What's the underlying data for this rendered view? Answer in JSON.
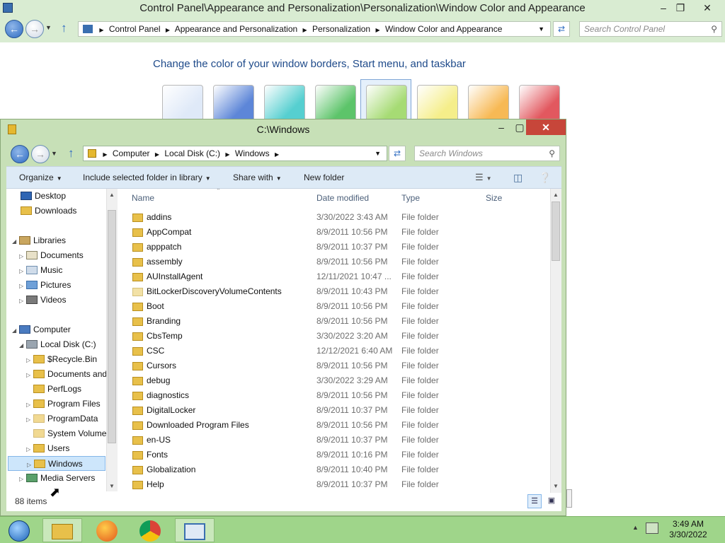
{
  "control_panel": {
    "title": "Control Panel\\Appearance and Personalization\\Personalization\\Window Color and Appearance",
    "breadcrumb": [
      "Control Panel",
      "Appearance and Personalization",
      "Personalization",
      "Window Color and Appearance"
    ],
    "search_placeholder": "Search Control Panel",
    "heading": "Change the color of your window borders, Start menu, and taskbar",
    "swatch_colors": [
      "#dfe9f8",
      "#5d86d8",
      "#56cfd0",
      "#5dc46a",
      "#a6db74",
      "#f5ee8a",
      "#f7b955",
      "#e2585f"
    ],
    "selected_swatch_index": 4
  },
  "explorer": {
    "title": "C:\\Windows",
    "breadcrumb": [
      "Computer",
      "Local Disk (C:)",
      "Windows"
    ],
    "search_placeholder": "Search Windows",
    "toolbar": {
      "organize": "Organize",
      "include_library": "Include selected folder in library",
      "share_with": "Share with",
      "new_folder": "New folder"
    },
    "nav": {
      "desktop": "Desktop",
      "downloads": "Downloads",
      "libraries": "Libraries",
      "documents": "Documents",
      "music": "Music",
      "pictures": "Pictures",
      "videos": "Videos",
      "computer": "Computer",
      "local_disk": "Local Disk (C:)",
      "recycle": "$Recycle.Bin",
      "docs_and": "Documents and",
      "perflogs": "PerfLogs",
      "program_files": "Program Files",
      "program_data": "ProgramData",
      "system_volume": "System Volume",
      "users": "Users",
      "windows": "Windows",
      "media_servers": "Media Servers"
    },
    "columns": {
      "name": "Name",
      "date": "Date modified",
      "type": "Type",
      "size": "Size"
    },
    "files": [
      {
        "name": "addins",
        "date": "3/30/2022 3:43 AM",
        "type": "File folder"
      },
      {
        "name": "AppCompat",
        "date": "8/9/2011 10:56 PM",
        "type": "File folder"
      },
      {
        "name": "apppatch",
        "date": "8/9/2011 10:37 PM",
        "type": "File folder"
      },
      {
        "name": "assembly",
        "date": "8/9/2011 10:56 PM",
        "type": "File folder"
      },
      {
        "name": "AUInstallAgent",
        "date": "12/11/2021 10:47 ...",
        "type": "File folder"
      },
      {
        "name": "BitLockerDiscoveryVolumeContents",
        "date": "8/9/2011 10:43 PM",
        "type": "File folder"
      },
      {
        "name": "Boot",
        "date": "8/9/2011 10:56 PM",
        "type": "File folder"
      },
      {
        "name": "Branding",
        "date": "8/9/2011 10:56 PM",
        "type": "File folder"
      },
      {
        "name": "CbsTemp",
        "date": "3/30/2022 3:20 AM",
        "type": "File folder"
      },
      {
        "name": "CSC",
        "date": "12/12/2021 6:40 AM",
        "type": "File folder"
      },
      {
        "name": "Cursors",
        "date": "8/9/2011 10:56 PM",
        "type": "File folder"
      },
      {
        "name": "debug",
        "date": "3/30/2022 3:29 AM",
        "type": "File folder"
      },
      {
        "name": "diagnostics",
        "date": "8/9/2011 10:56 PM",
        "type": "File folder"
      },
      {
        "name": "DigitalLocker",
        "date": "8/9/2011 10:37 PM",
        "type": "File folder"
      },
      {
        "name": "Downloaded Program Files",
        "date": "8/9/2011 10:56 PM",
        "type": "File folder"
      },
      {
        "name": "en-US",
        "date": "8/9/2011 10:37 PM",
        "type": "File folder"
      },
      {
        "name": "Fonts",
        "date": "8/9/2011 10:16 PM",
        "type": "File folder"
      },
      {
        "name": "Globalization",
        "date": "8/9/2011 10:40 PM",
        "type": "File folder"
      },
      {
        "name": "Help",
        "date": "8/9/2011 10:37 PM",
        "type": "File folder"
      }
    ],
    "status": "88 items"
  },
  "taskbar": {
    "time": "3:49 AM",
    "date": "3/30/2022"
  }
}
